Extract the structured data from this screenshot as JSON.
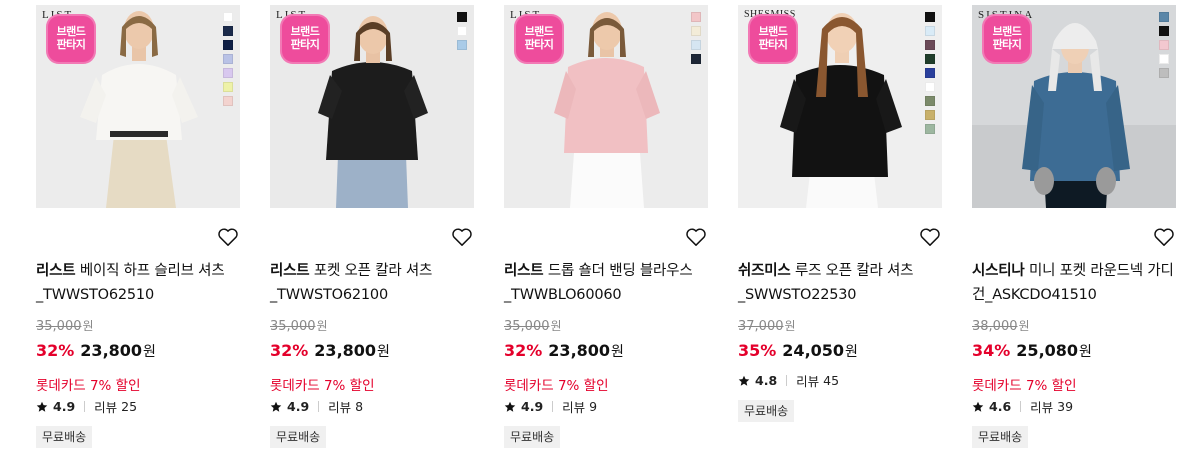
{
  "badge": {
    "line1": "브랜드",
    "line2": "판타지"
  },
  "products": [
    {
      "brand_mark": "LIST",
      "brand": "리스트",
      "name": " 베이직 하프 슬리브 셔츠_TWWSTO62510",
      "original_price": "35,000",
      "discount": "32%",
      "sale_price": "23,800",
      "currency": "원",
      "card_offer": "롯데카드 7% 할인",
      "rating": "4.9",
      "review_label": "리뷰",
      "review_count": "25",
      "shipping": "무료배송",
      "wishlist_icon": "heart-outline-icon",
      "swatch_colors": [
        "#ffffff",
        "#1b2a4a",
        "#0f1f45",
        "#b9c2e6",
        "#d8c8ef",
        "#eef2a8",
        "#f3d3cf"
      ]
    },
    {
      "brand_mark": "LIST",
      "brand": "리스트",
      "name": " 포켓 오픈 칼라 셔츠_TWWSTO62100",
      "original_price": "35,000",
      "discount": "32%",
      "sale_price": "23,800",
      "currency": "원",
      "card_offer": "롯데카드 7% 할인",
      "rating": "4.9",
      "review_label": "리뷰",
      "review_count": "8",
      "shipping": "무료배송",
      "wishlist_icon": "heart-outline-icon",
      "swatch_colors": [
        "#111111",
        "#ffffff",
        "#a9cbe8"
      ]
    },
    {
      "brand_mark": "LIST",
      "brand": "리스트",
      "name": " 드롭 숄더 밴딩 블라우스_TWWBLO60060",
      "original_price": "35,000",
      "discount": "32%",
      "sale_price": "23,800",
      "currency": "원",
      "card_offer": "롯데카드 7% 할인",
      "rating": "4.9",
      "review_label": "리뷰",
      "review_count": "9",
      "shipping": "무료배송",
      "wishlist_icon": "heart-outline-icon",
      "swatch_colors": [
        "#f2c6c8",
        "#f3ecd8",
        "#d6e6f2",
        "#1d2636"
      ]
    },
    {
      "brand_mark": "SHESMISS",
      "brand": "쉬즈미스",
      "name": " 루즈 오픈 칼라 셔츠_SWWSTO22530",
      "original_price": "37,000",
      "discount": "35%",
      "sale_price": "24,050",
      "currency": "원",
      "card_offer": "",
      "rating": "4.8",
      "review_label": "리뷰",
      "review_count": "45",
      "shipping": "무료배송",
      "wishlist_icon": "heart-outline-icon",
      "swatch_colors": [
        "#111111",
        "#d9ebf7",
        "#6b4a58",
        "#1f3d2a",
        "#2a3f9c",
        "#ffffff",
        "#7b8a6a",
        "#c8b06a",
        "#9db7a0"
      ]
    },
    {
      "brand_mark": "SISTINA",
      "brand": "시스티나",
      "name": " 미니 포켓 라운드넥 가디건_ASKCDO41510",
      "original_price": "38,000",
      "discount": "34%",
      "sale_price": "25,080",
      "currency": "원",
      "card_offer": "롯데카드 7% 할인",
      "rating": "4.6",
      "review_label": "리뷰",
      "review_count": "39",
      "shipping": "무료배송",
      "wishlist_icon": "heart-outline-icon",
      "swatch_colors": [
        "#5a86a8",
        "#111111",
        "#f3c8d0",
        "#ffffff",
        "#bdbdbd"
      ]
    }
  ]
}
